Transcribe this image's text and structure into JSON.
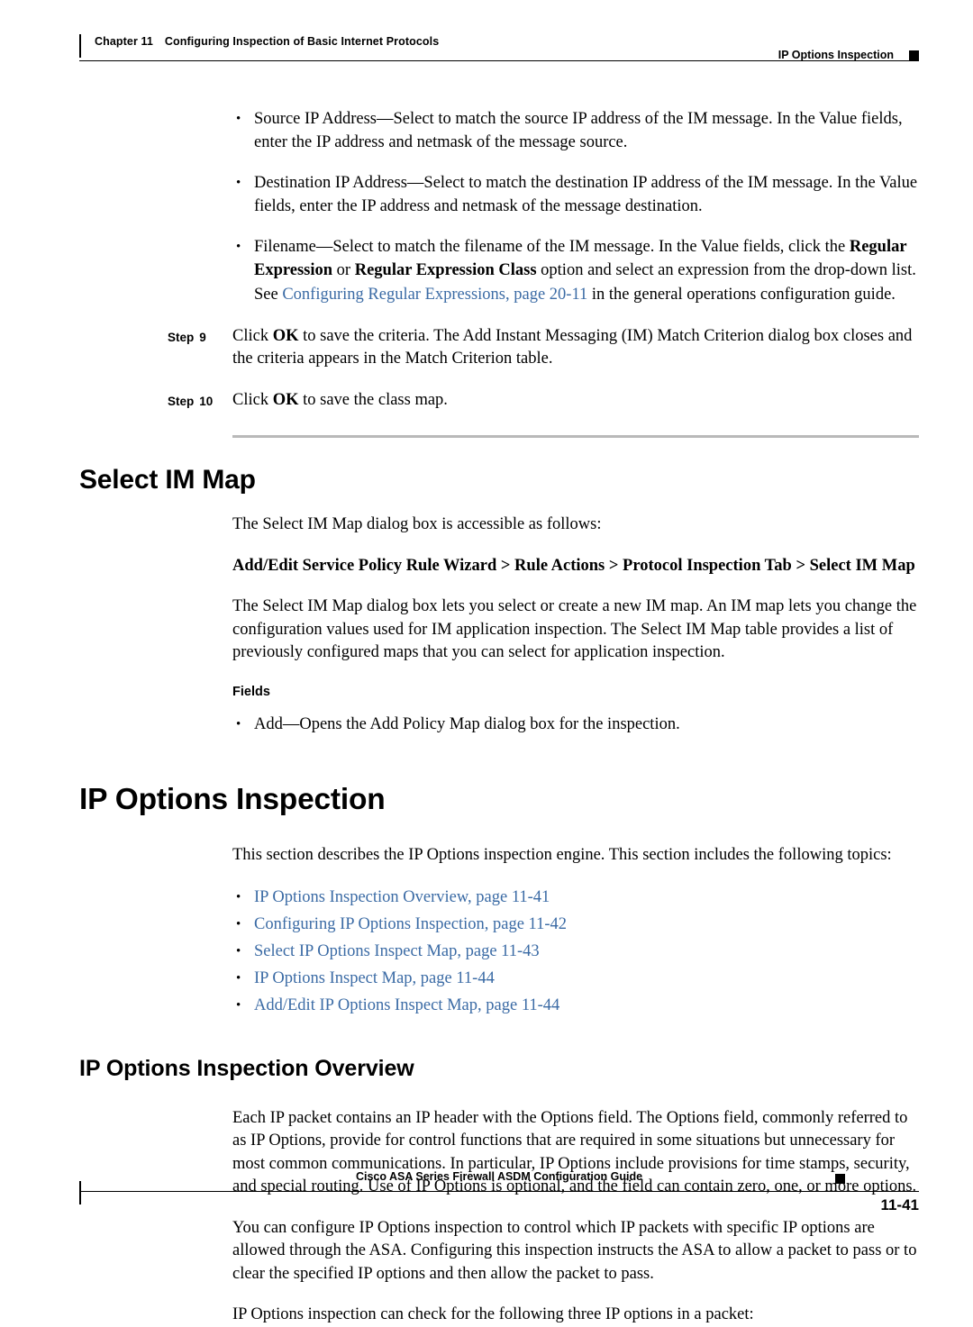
{
  "header": {
    "chapter": "Chapter 11",
    "chapter_title": "Configuring Inspection of Basic Internet Protocols",
    "right_title": "IP Options Inspection"
  },
  "bullets": [
    {
      "parts": [
        {
          "text": "Source IP Address—Select to match the source IP address of the IM message. In the Value fields, enter the IP address and netmask of the message source.",
          "style": "normal"
        }
      ]
    },
    {
      "parts": [
        {
          "text": "Destination IP Address—Select to match the destination IP address of the IM message. In the Value fields, enter the IP address and netmask of the message destination.",
          "style": "normal"
        }
      ]
    },
    {
      "parts": [
        {
          "text": "Filename—Select to match the filename of the IM message. In the Value fields, click the ",
          "style": "normal"
        },
        {
          "text": "Regular Expression",
          "style": "bold"
        },
        {
          "text": " or ",
          "style": "normal"
        },
        {
          "text": "Regular Expression Class",
          "style": "bold"
        },
        {
          "text": " option and select an expression from the drop-down list.",
          "style": "normal"
        }
      ]
    }
  ],
  "see_line": {
    "prefix": "See ",
    "link": "Configuring Regular Expressions, page 20-11",
    "suffix": " in the general operations configuration guide."
  },
  "steps": [
    {
      "label": "Step",
      "number": "9",
      "parts": [
        {
          "text": "Click ",
          "style": "normal"
        },
        {
          "text": "OK",
          "style": "bold"
        },
        {
          "text": " to save the criteria. The Add Instant Messaging (IM) Match Criterion dialog box closes and the criteria appears in the Match Criterion table.",
          "style": "normal"
        }
      ]
    },
    {
      "label": "Step",
      "number": "10",
      "parts": [
        {
          "text": "Click ",
          "style": "normal"
        },
        {
          "text": "OK",
          "style": "bold"
        },
        {
          "text": " to save the class map.",
          "style": "normal"
        }
      ]
    }
  ],
  "select_im_map": {
    "title": "Select IM Map",
    "intro": "The Select IM Map dialog box is accessible as follows:",
    "path": "Add/Edit Service Policy Rule Wizard > Rule Actions > Protocol Inspection Tab > Select IM Map",
    "description": "The Select IM Map dialog box lets you select or create a new IM map. An IM map lets you change the configuration values used for IM application inspection. The Select IM Map table provides a list of previously configured maps that you can select for application inspection.",
    "fields_label": "Fields",
    "field_bullet": "Add—Opens the Add Policy Map dialog box for the inspection."
  },
  "ip_options": {
    "title": "IP Options Inspection",
    "intro": "This section describes the IP Options inspection engine. This section includes the following topics:",
    "topics": [
      "IP Options Inspection Overview, page 11-41",
      "Configuring IP Options Inspection, page 11-42",
      "Select IP Options Inspect Map, page 11-43",
      "IP Options Inspect Map, page 11-44",
      "Add/Edit IP Options Inspect Map, page 11-44"
    ],
    "overview_title": "IP Options Inspection Overview",
    "overview_paragraphs": [
      "Each IP packet contains an IP header with the Options field. The Options field, commonly referred to as IP Options, provide for control functions that are required in some situations but unnecessary for most common communications. In particular, IP Options include provisions for time stamps, security, and special routing. Use of IP Options is optional, and the field can contain zero, one, or more options.",
      "You can configure IP Options inspection to control which IP packets with specific IP options are allowed through the ASA. Configuring this inspection instructs the ASA to allow a packet to pass or to clear the specified IP options and then allow the packet to pass.",
      "IP Options inspection can check for the following three IP options in a packet:"
    ]
  },
  "footer": {
    "guide_title": "Cisco ASA Series Firewall ASDM Configuration Guide",
    "page_number": "11-41"
  },
  "colors": {
    "link": "#3b6ba5",
    "rule": "#b9b9b9"
  }
}
